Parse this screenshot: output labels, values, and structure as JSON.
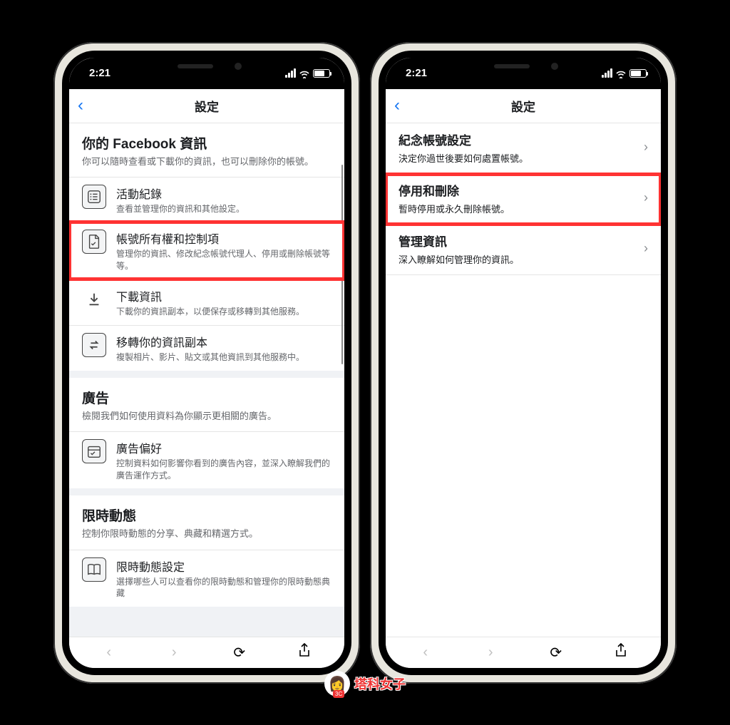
{
  "status": {
    "time": "2:21"
  },
  "left": {
    "nav_title": "設定",
    "section1": {
      "title": "你的 Facebook 資訊",
      "desc": "你可以隨時查看或下載你的資訊，也可以刪除你的帳號。",
      "items": [
        {
          "title": "活動紀錄",
          "desc": "查看並管理你的資訊和其他設定。"
        },
        {
          "title": "帳號所有權和控制項",
          "desc": "管理你的資訊、修改紀念帳號代理人、停用或刪除帳號等等。"
        },
        {
          "title": "下載資訊",
          "desc": "下載你的資訊副本，以便保存或移轉到其他服務。"
        },
        {
          "title": "移轉你的資訊副本",
          "desc": "複製相片、影片、貼文或其他資訊到其他服務中。"
        }
      ]
    },
    "section2": {
      "title": "廣告",
      "desc": "檢閱我們如何使用資料為你顯示更相關的廣告。",
      "items": [
        {
          "title": "廣告偏好",
          "desc": "控制資料如何影響你看到的廣告內容，並深入瞭解我們的廣告運作方式。"
        }
      ]
    },
    "section3": {
      "title": "限時動態",
      "desc": "控制你限時動態的分享、典藏和精選方式。",
      "items": [
        {
          "title": "限時動態設定",
          "desc": "選擇哪些人可以查看你的限時動態和管理你的限時動態典藏"
        }
      ]
    }
  },
  "right": {
    "nav_title": "設定",
    "rows": [
      {
        "title": "紀念帳號設定",
        "desc": "決定你過世後要如何處置帳號。"
      },
      {
        "title": "停用和刪除",
        "desc": "暫時停用或永久刪除帳號。"
      },
      {
        "title": "管理資訊",
        "desc": "深入瞭解如何管理你的資訊。"
      }
    ]
  },
  "watermark": {
    "text": "塔科女子",
    "badge": "3C"
  }
}
